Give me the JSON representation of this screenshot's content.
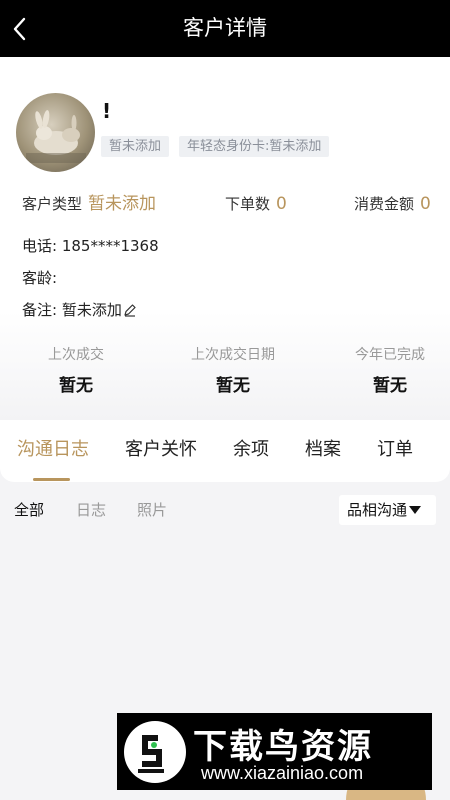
{
  "header": {
    "title": "客户详情",
    "back_icon": "chevron-left-icon"
  },
  "customer": {
    "name": "!",
    "tags": [
      "暂未添加",
      "年轻态身份卡:暂未添加"
    ],
    "stats": [
      {
        "label": "客户类型",
        "value": "暂未添加"
      },
      {
        "label": "下单数",
        "value": "0"
      },
      {
        "label": "消费金额",
        "value": "0"
      }
    ],
    "phone": "电话: 185****1368",
    "age": "客龄:",
    "note": "备注: 暂未添加",
    "note_edit_icon": "pencil-icon"
  },
  "summary": [
    {
      "label": "上次成交",
      "value": "暂无"
    },
    {
      "label": "上次成交日期",
      "value": "暂无"
    },
    {
      "label": "今年已完成",
      "value": "暂无"
    }
  ],
  "tabs": [
    "沟通日志",
    "客户关怀",
    "余项",
    "档案",
    "订单"
  ],
  "active_tab": "沟通日志",
  "subtabs": [
    "全部",
    "日志",
    "照片"
  ],
  "active_subtab": "全部",
  "filter": {
    "selected": "品相沟通"
  },
  "watermark": {
    "title": "下载鸟资源",
    "url": "www.xiazainiao.com"
  },
  "colors": {
    "accent": "#b8955d",
    "header_bg": "#000000",
    "page_bg": "#f4f4f6"
  }
}
